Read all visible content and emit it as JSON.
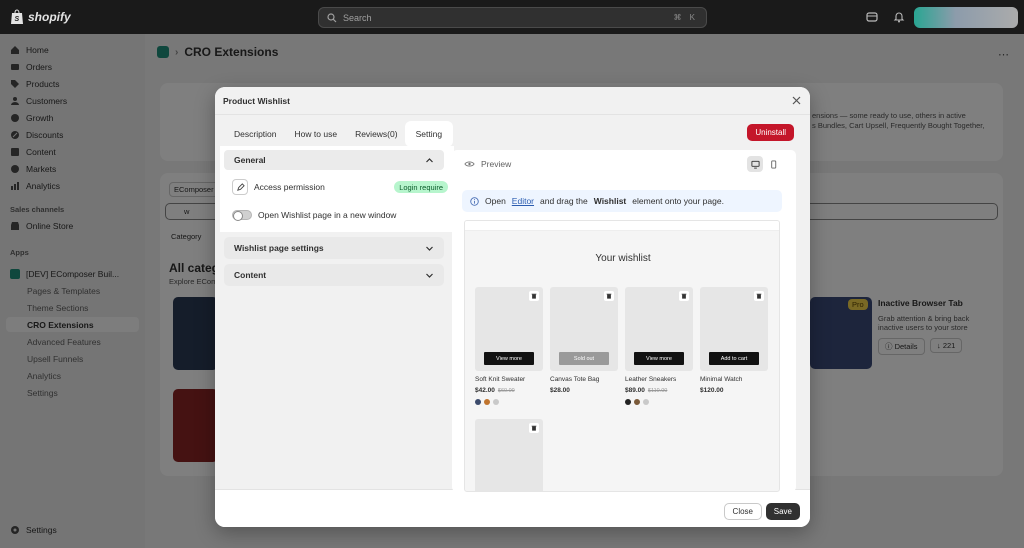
{
  "topbar": {
    "brand": "shopify",
    "search_placeholder": "Search",
    "search_shortcut": "⌘ K"
  },
  "sidebar": {
    "items": [
      {
        "label": "Home",
        "icon": "home-icon"
      },
      {
        "label": "Orders",
        "icon": "orders-icon"
      },
      {
        "label": "Products",
        "icon": "tag-icon"
      },
      {
        "label": "Customers",
        "icon": "person-icon"
      },
      {
        "label": "Growth",
        "icon": "growth-icon"
      },
      {
        "label": "Discounts",
        "icon": "discount-icon"
      },
      {
        "label": "Content",
        "icon": "content-icon"
      },
      {
        "label": "Markets",
        "icon": "globe-icon"
      },
      {
        "label": "Analytics",
        "icon": "analytics-icon"
      }
    ],
    "sales_channels_label": "Sales channels",
    "online_store": "Online Store",
    "apps_label": "Apps",
    "app_name": "[DEV] EComposer Buil...",
    "app_subitems": [
      "Pages & Templates",
      "Theme Sections",
      "CRO Extensions",
      "Advanced Features",
      "Upsell Funnels",
      "Analytics",
      "Settings"
    ],
    "active_subitem": "CRO Extensions",
    "settings": "Settings"
  },
  "page": {
    "title": "CRO Extensions",
    "bg_text_1": "ensions — some ready to use, others in active",
    "bg_text_2": "s Bundles, Cart Upsell, Frequently Bought Together,",
    "bg_tab": "EComposer",
    "bg_search": "w",
    "bg_category": "Category",
    "bg_all_categories": "All categ",
    "bg_explore": "Explore ECom",
    "bg_card_badge": "Pro",
    "bg_card_title": "Inactive Browser Tab",
    "bg_card_desc_1": "Grab attention & bring back",
    "bg_card_desc_2": "inactive users to your store",
    "bg_card_details": "Details",
    "bg_card_count": "221"
  },
  "modal": {
    "title": "Product Wishlist",
    "tabs": [
      "Description",
      "How to use",
      "Reviews(0)",
      "Setting"
    ],
    "active_tab": "Setting",
    "uninstall": "Uninstall",
    "general": {
      "title": "General",
      "access_permission": "Access permission",
      "access_value": "Login require",
      "open_new_window": "Open Wishlist page in a new window",
      "open_new_window_on": false
    },
    "accordions": [
      "Wishlist page settings",
      "Content"
    ],
    "preview": {
      "label": "Preview",
      "info_prefix": "Open",
      "info_link": "Editor",
      "info_middle": "and drag the",
      "info_bold": "Wishlist",
      "info_suffix": "element onto your page.",
      "wishlist_title": "Your wishlist",
      "products": [
        {
          "name": "Soft Knit Sweater",
          "price": "$42.00",
          "compare": "$60.00",
          "button": "View more",
          "sold_out": false,
          "swatches": [
            "#3b4a6b",
            "#c0742e",
            "#c9c9c9"
          ]
        },
        {
          "name": "Canvas Tote Bag",
          "price": "$28.00",
          "compare": "",
          "button": "Sold out",
          "sold_out": true,
          "swatches": []
        },
        {
          "name": "Leather Sneakers",
          "price": "$89.00",
          "compare": "$110.00",
          "button": "View more",
          "sold_out": false,
          "swatches": [
            "#222222",
            "#7a5a3a",
            "#c9c9c9"
          ]
        },
        {
          "name": "Minimal Watch",
          "price": "$120.00",
          "compare": "",
          "button": "Add to cart",
          "sold_out": false,
          "swatches": []
        }
      ]
    },
    "footer": {
      "close": "Close",
      "save": "Save"
    }
  }
}
